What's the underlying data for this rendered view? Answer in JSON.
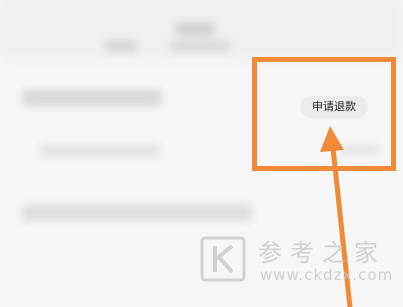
{
  "refund": {
    "label": "申请退款"
  },
  "watermark": {
    "title": "参考之家",
    "url": "www.ckdzx.com"
  },
  "colors": {
    "highlight": "#f18a37",
    "button_bg": "#ececec",
    "page_bg": "#f6f6f6"
  }
}
